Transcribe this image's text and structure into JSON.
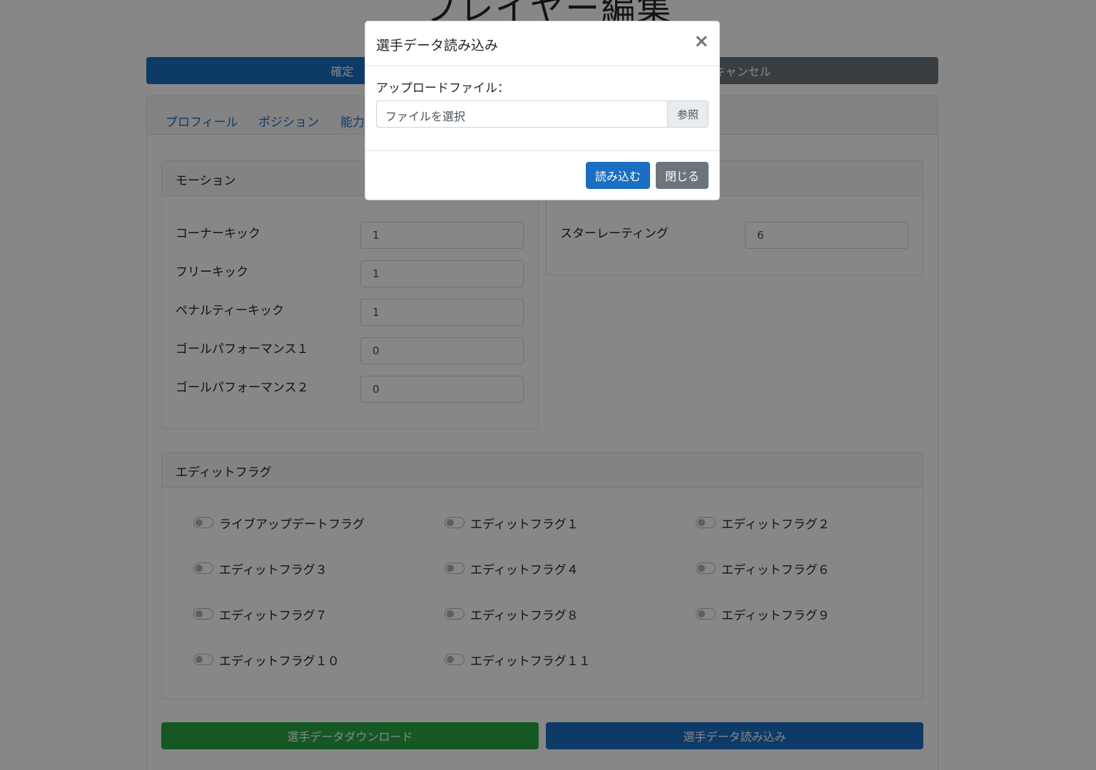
{
  "page": {
    "title": "プレイヤー編集"
  },
  "actions": {
    "confirm_label": "確定",
    "cancel_label": "キャンセル"
  },
  "tabs": [
    {
      "label": "プロフィール"
    },
    {
      "label": "ポジション"
    },
    {
      "label": "能力"
    }
  ],
  "motion": {
    "header": "モーション",
    "fields": [
      {
        "label": "コーナーキック",
        "value": "1"
      },
      {
        "label": "フリーキック",
        "value": "1"
      },
      {
        "label": "ペナルティーキック",
        "value": "1"
      },
      {
        "label": "ゴールパフォーマンス１",
        "value": "0"
      },
      {
        "label": "ゴールパフォーマンス２",
        "value": "0"
      }
    ]
  },
  "rating": {
    "fields": [
      {
        "label": "スターレーティング",
        "value": "6"
      }
    ]
  },
  "edit_flags": {
    "header": "エディットフラグ",
    "items": [
      {
        "label": "ライブアップデートフラグ",
        "checked": false
      },
      {
        "label": "エディットフラグ１",
        "checked": false
      },
      {
        "label": "エディットフラグ２",
        "checked": false
      },
      {
        "label": "エディットフラグ３",
        "checked": false
      },
      {
        "label": "エディットフラグ４",
        "checked": false
      },
      {
        "label": "エディットフラグ６",
        "checked": false
      },
      {
        "label": "エディットフラグ７",
        "checked": false
      },
      {
        "label": "エディットフラグ８",
        "checked": false
      },
      {
        "label": "エディットフラグ９",
        "checked": false
      },
      {
        "label": "エディットフラグ１０",
        "checked": false
      },
      {
        "label": "エディットフラグ１１",
        "checked": false
      }
    ]
  },
  "bottom_actions": {
    "download_label": "選手データダウンロード",
    "load_label": "選手データ読み込み"
  },
  "modal": {
    "title": "選手データ読み込み",
    "close_glyph": "×",
    "upload_label": "アップロードファイル：",
    "file_placeholder": "ファイルを選択",
    "browse_label": "参照",
    "submit_label": "読み込む",
    "close_label": "閉じる"
  },
  "colors": {
    "primary": "#1b6ec2",
    "secondary": "#6c757d",
    "success": "#28a745"
  }
}
